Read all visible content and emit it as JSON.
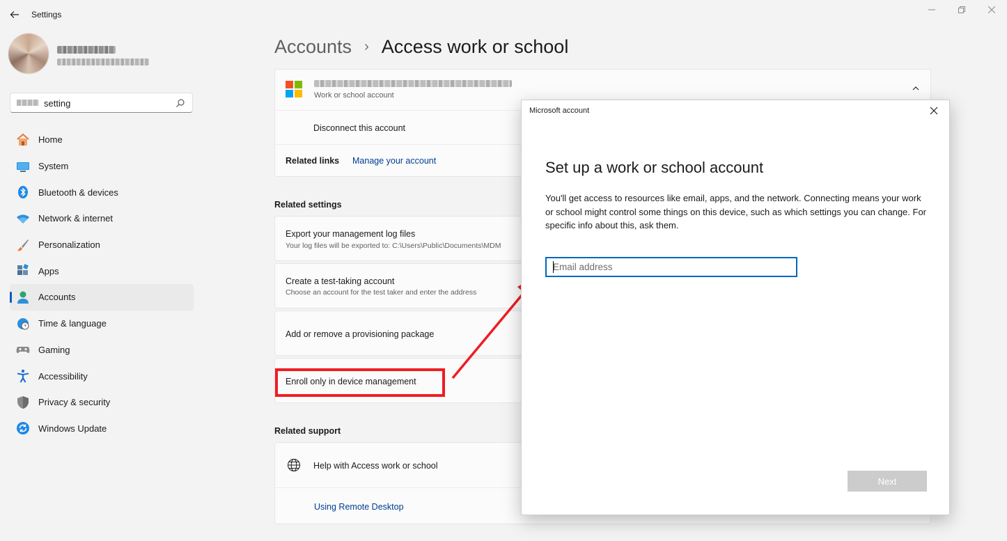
{
  "window": {
    "title": "Settings",
    "controls": [
      "minimize-icon",
      "restore-icon",
      "close-icon"
    ]
  },
  "profile": {
    "avatar": "user-avatar"
  },
  "search": {
    "text": "setting"
  },
  "nav": {
    "items": [
      {
        "label": "Home",
        "icon": "home-icon"
      },
      {
        "label": "System",
        "icon": "system-icon"
      },
      {
        "label": "Bluetooth & devices",
        "icon": "bluetooth-icon"
      },
      {
        "label": "Network & internet",
        "icon": "wifi-icon"
      },
      {
        "label": "Personalization",
        "icon": "brush-icon"
      },
      {
        "label": "Apps",
        "icon": "apps-icon"
      },
      {
        "label": "Accounts",
        "icon": "accounts-icon",
        "active": true
      },
      {
        "label": "Time & language",
        "icon": "globe-clock-icon"
      },
      {
        "label": "Gaming",
        "icon": "gamepad-icon"
      },
      {
        "label": "Accessibility",
        "icon": "accessibility-icon"
      },
      {
        "label": "Privacy & security",
        "icon": "shield-icon"
      },
      {
        "label": "Windows Update",
        "icon": "update-icon"
      }
    ]
  },
  "breadcrumb": {
    "parent": "Accounts",
    "separator": "›",
    "current": "Access work or school"
  },
  "account_card": {
    "type_label": "Work or school account",
    "disconnect_label": "Disconnect this account",
    "related_links_label": "Related links",
    "manage_link": "Manage your account"
  },
  "related_settings": {
    "title": "Related settings",
    "items": [
      {
        "title": "Export your management log files",
        "desc": "Your log files will be exported to: C:\\Users\\Public\\Documents\\MDM"
      },
      {
        "title": "Create a test-taking account",
        "desc": "Choose an account for the test taker and enter the address"
      },
      {
        "title": "Add or remove a provisioning package",
        "desc": ""
      },
      {
        "title": "Enroll only in device management",
        "desc": ""
      }
    ]
  },
  "related_support": {
    "title": "Related support",
    "help_label": "Help with Access work or school",
    "remote_link": "Using Remote Desktop"
  },
  "dialog": {
    "title": "Microsoft account",
    "heading": "Set up a work or school account",
    "body": "You'll get access to resources like email, apps, and the network. Connecting means your work or school might control some things on this device, such as which settings you can change. For specific info about this, ask them.",
    "email_placeholder": "Email address",
    "email_value": "",
    "next_label": "Next"
  },
  "colors": {
    "accent": "#005fb8",
    "link": "#003e92",
    "highlight_red": "#ee1d23",
    "input_border": "#0067c0"
  }
}
